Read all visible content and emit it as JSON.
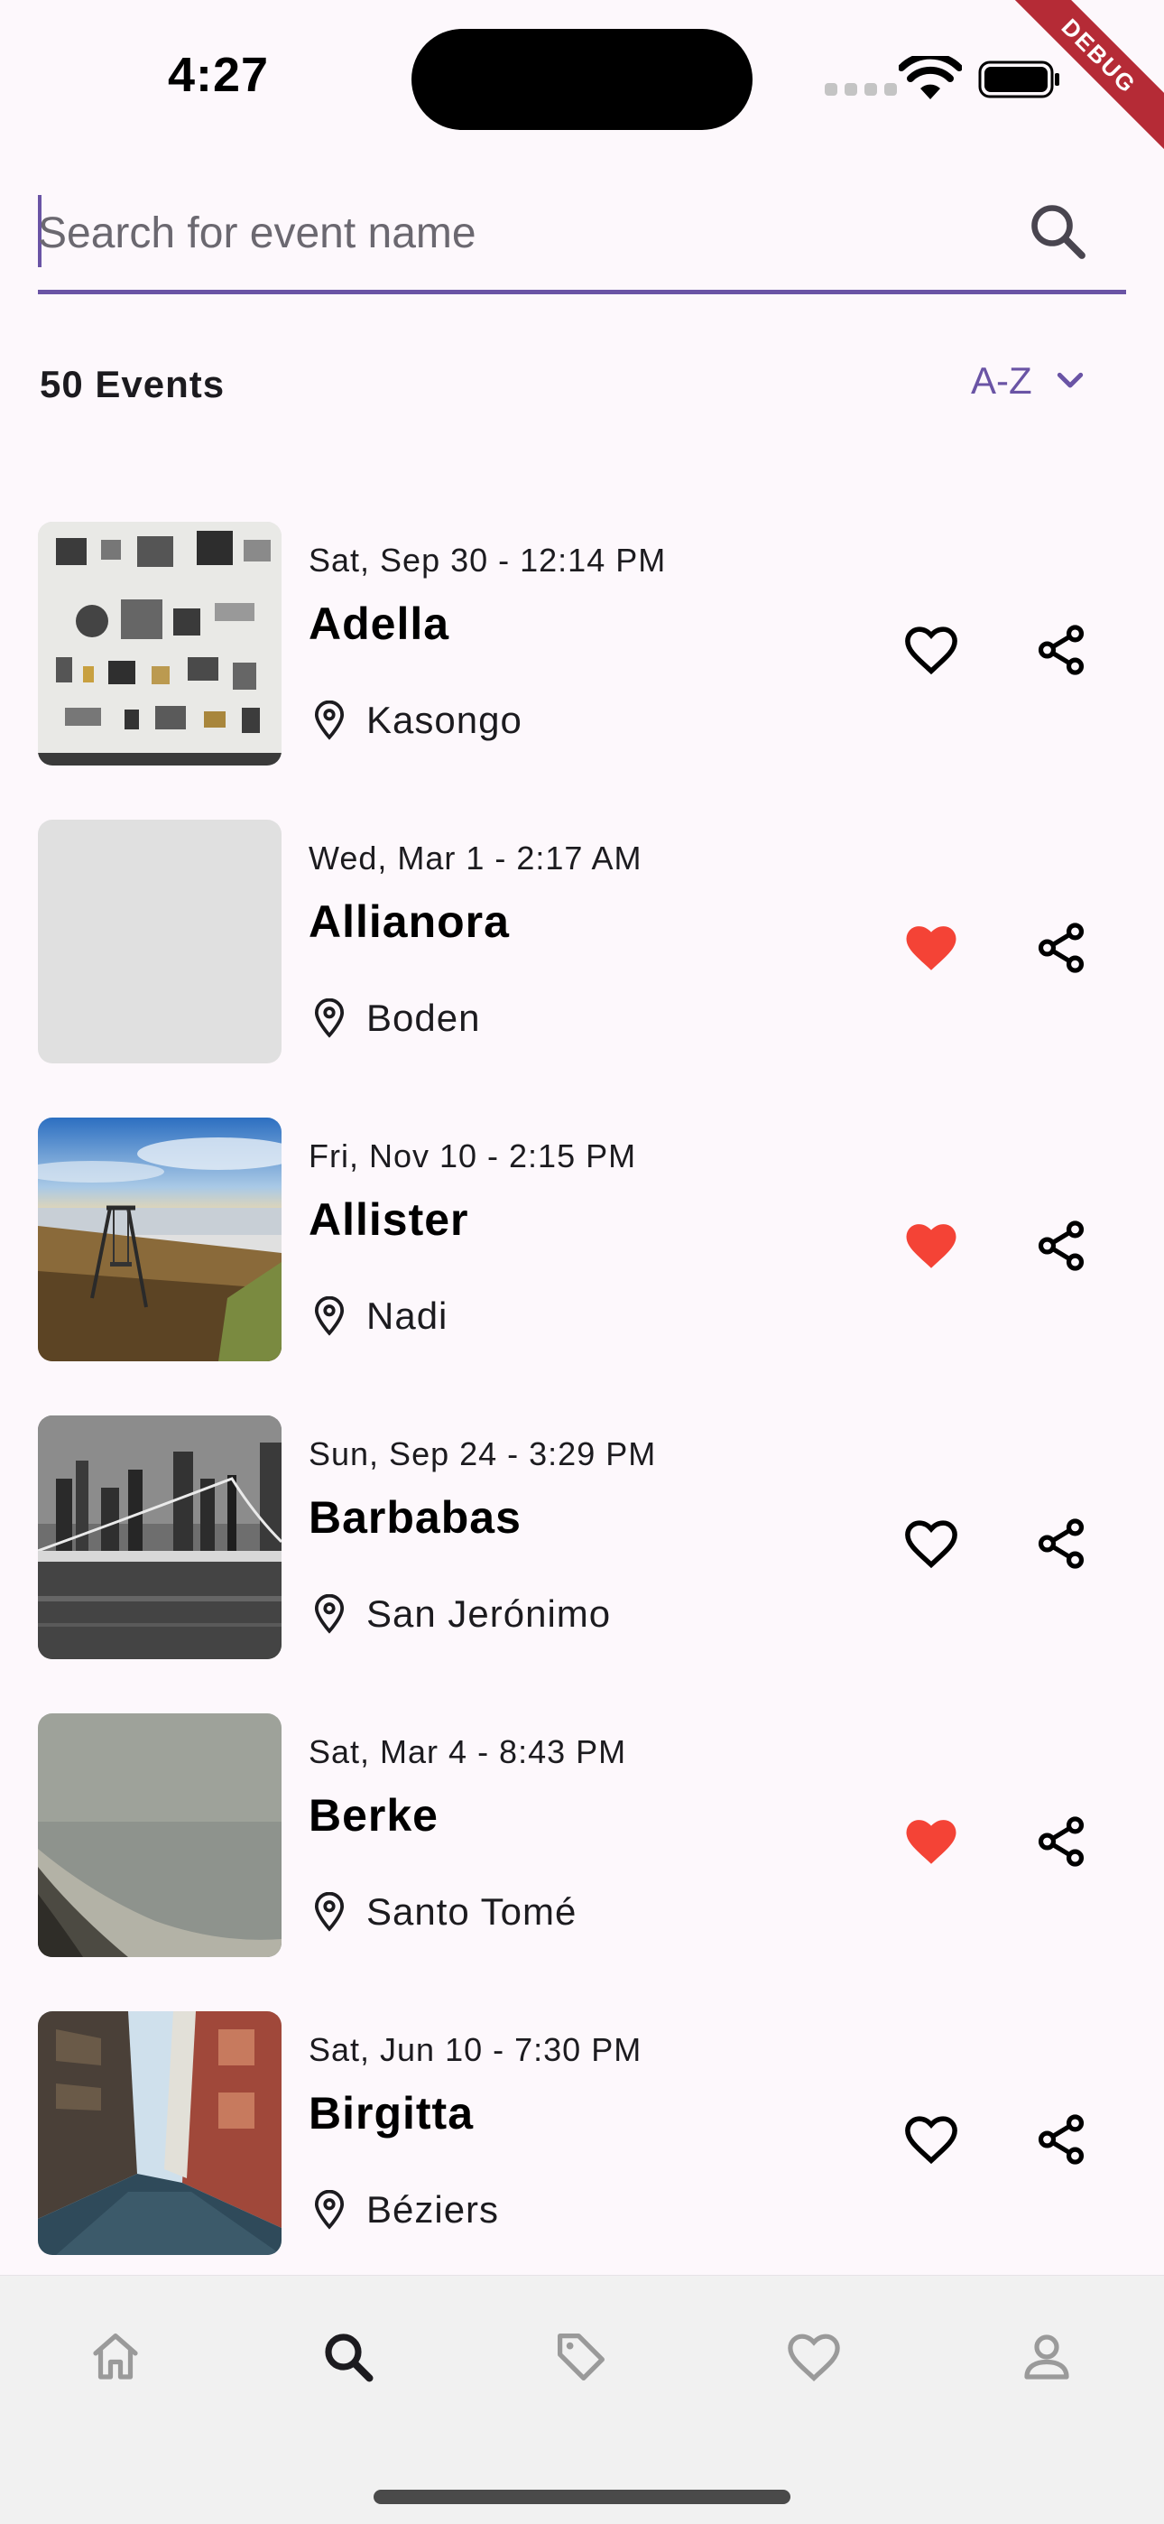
{
  "status_bar": {
    "time": "4:27",
    "debug_label": "DEBUG"
  },
  "search": {
    "placeholder": "Search for event name",
    "value": ""
  },
  "list_header": {
    "count_label": "50 Events",
    "sort_label": "A-Z"
  },
  "colors": {
    "accent": "#6a54a5",
    "favorite": "#f44336",
    "background": "#fdf8fc",
    "nav_bg": "#f1f1f1"
  },
  "events": [
    {
      "date": "Sat, Sep 30 - 12:14 PM",
      "name": "Adella",
      "location": "Kasongo",
      "favorite": false,
      "image": "flatlay-tools-photo"
    },
    {
      "date": "Wed, Mar 1 - 2:17 AM",
      "name": "Allianora",
      "location": "Boden",
      "favorite": true,
      "image": "placeholder"
    },
    {
      "date": "Fri, Nov 10 - 2:15 PM",
      "name": "Allister",
      "location": "Nadi",
      "favorite": true,
      "image": "coast-swing-photo"
    },
    {
      "date": "Sun, Sep 24 - 3:29 PM",
      "name": "Barbabas",
      "location": "San Jerónimo",
      "favorite": false,
      "image": "bridge-night-photo"
    },
    {
      "date": "Sat, Mar 4 - 8:43 PM",
      "name": "Berke",
      "location": "Santo Tomé",
      "favorite": true,
      "image": "foggy-beach-photo"
    },
    {
      "date": "Sat, Jun 10 - 7:30 PM",
      "name": "Birgitta",
      "location": "Béziers",
      "favorite": false,
      "image": "city-street-photo"
    }
  ],
  "bottom_nav": [
    {
      "id": "home",
      "icon": "home-icon",
      "active": false
    },
    {
      "id": "search",
      "icon": "search-icon",
      "active": true
    },
    {
      "id": "tags",
      "icon": "tag-icon",
      "active": false
    },
    {
      "id": "favorites",
      "icon": "heart-icon",
      "active": false
    },
    {
      "id": "profile",
      "icon": "person-icon",
      "active": false
    }
  ]
}
